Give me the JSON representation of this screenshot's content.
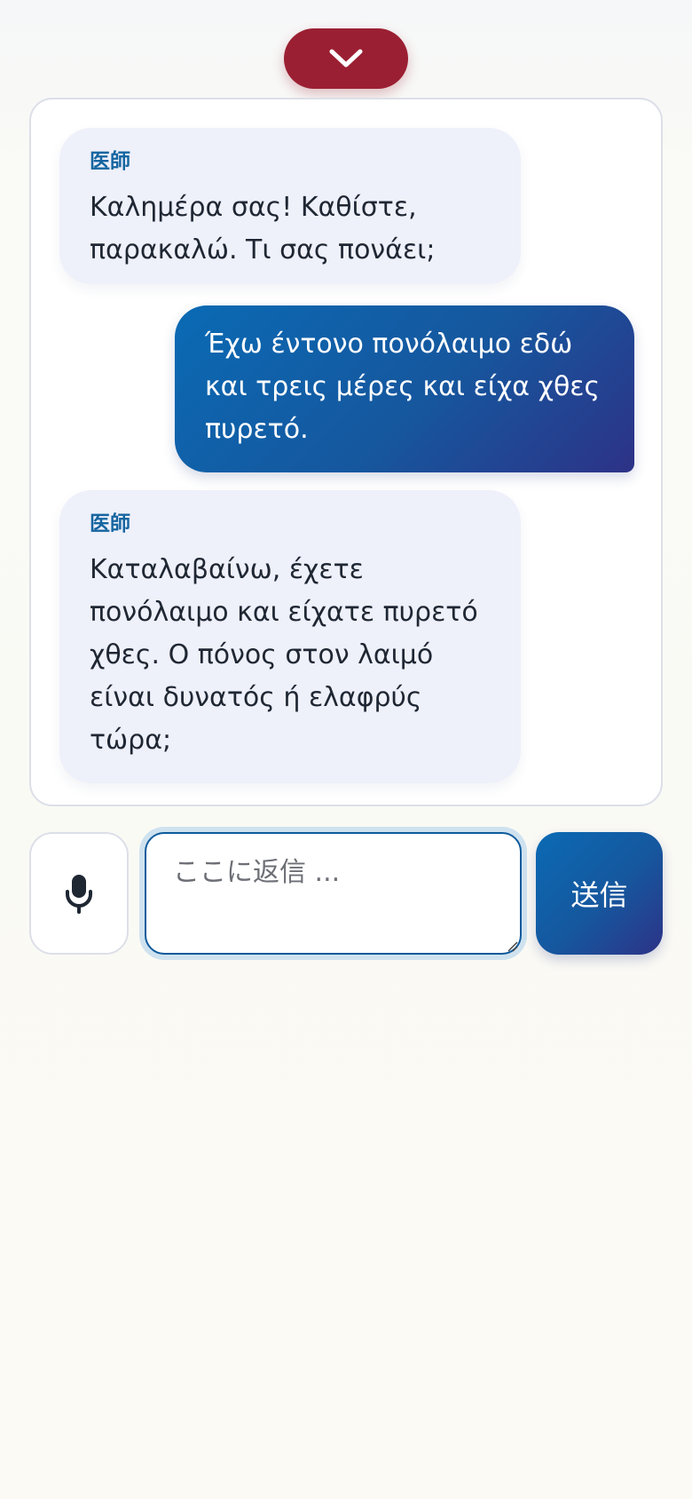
{
  "header": {
    "collapse_icon": "chevron-down-icon",
    "accent_color": "#9b1f32"
  },
  "conversation": {
    "messages": [
      {
        "role": "doctor",
        "sender": "医師",
        "text": "Καλημέρα σας! Καθίστε, παρακαλώ. Τι σας πονάει;"
      },
      {
        "role": "patient",
        "text": "Έχω έντονο πονόλαιμο εδώ και τρεις μέρες και είχα χθες πυρετό."
      },
      {
        "role": "doctor",
        "sender": "医師",
        "text": "Καταλαβαίνω, έχετε πονόλαιμο και είχατε πυρετό χθες. Ο πόνος στον λαιμό είναι δυνατός ή ελαφρύς τώρα;"
      }
    ]
  },
  "composer": {
    "mic_icon": "microphone-icon",
    "placeholder": "ここに返信 ...",
    "value": "",
    "send_label": "送信"
  },
  "colors": {
    "doctor_bubble": "#eef0fa",
    "patient_bubble": "#16579e",
    "sender_label": "#1565a0"
  }
}
